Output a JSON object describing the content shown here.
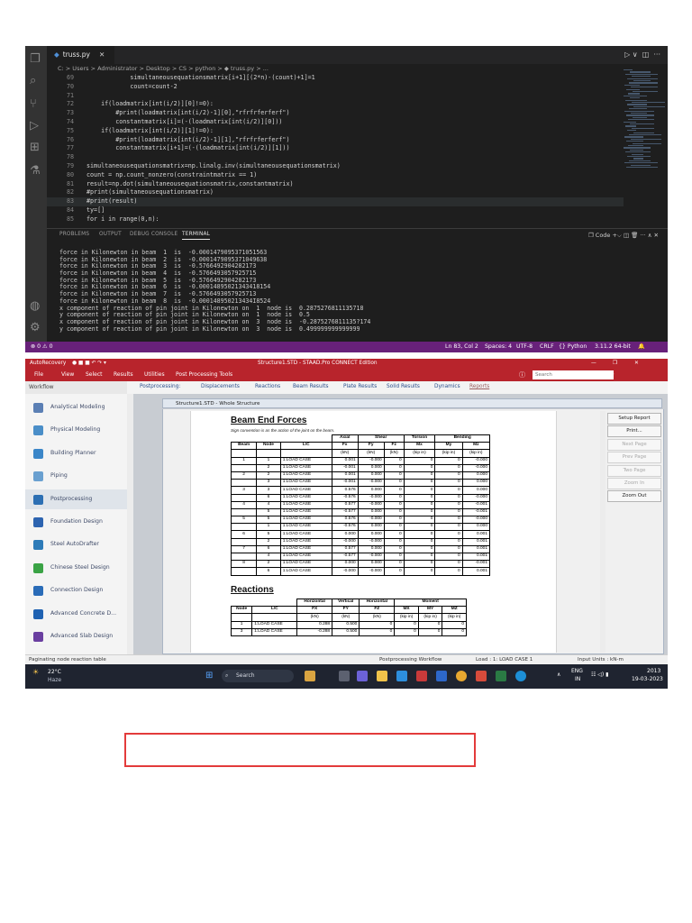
{
  "vscode": {
    "tab_title": "truss.py",
    "tab_icon": "python-file-icon",
    "breadcrumb": "C: > Users > Administrator > Desktop > CS > python > ◆ truss.py > ...",
    "code_lines": [
      {
        "n": "69",
        "text": "            simultaneousequationsmatrix[i+1][(2*n)-(count)+1]=1"
      },
      {
        "n": "70",
        "text": "            count=count-2"
      },
      {
        "n": "71",
        "text": ""
      },
      {
        "n": "72",
        "text": "    if(loadmatrix[int(i/2)][0]!=0):"
      },
      {
        "n": "73",
        "text": "        #print(loadmatrix[int(i/2)-1][0],\"rfrfrferferf\")"
      },
      {
        "n": "74",
        "text": "        constantmatrix[i]=(-(loadmatrix[int(i/2)][0]))"
      },
      {
        "n": "75",
        "text": "    if(loadmatrix[int(i/2)][1]!=0):"
      },
      {
        "n": "76",
        "text": "        #print(loadmatrix[int(i/2)-1][1],\"rfrfrferferf\")"
      },
      {
        "n": "77",
        "text": "        constantmatrix[i+1]=(-(loadmatrix[int(i/2)][1]))"
      },
      {
        "n": "78",
        "text": ""
      },
      {
        "n": "79",
        "text": "simultaneousequationsmatrix=np.linalg.inv(simultaneousequationsmatrix)"
      },
      {
        "n": "80",
        "text": "count = np.count_nonzero(constraintmatrix == 1)"
      },
      {
        "n": "81",
        "text": "result=np.dot(simultaneousequationsmatrix,constantmatrix)"
      },
      {
        "n": "82",
        "text": "#print(simultaneousequationsmatrix)"
      },
      {
        "n": "83",
        "text": "#print(result)"
      },
      {
        "n": "84",
        "text": "ty=[]"
      },
      {
        "n": "85",
        "text": "for i in range(0,n):"
      }
    ],
    "panel_tabs": [
      "PROBLEMS",
      "OUTPUT",
      "DEBUG CONSOLE",
      "TERMINAL"
    ],
    "panel_active": "TERMINAL",
    "panel_actions": "❐ Code  +⌵  ◫  🗑  ···  ∧  ✕",
    "terminal_lines": [
      "force in Kilonewton in beam  1  is  -0.0001479095371051563",
      "force in Kilonewton in beam  2  is  -0.0001479095371049638",
      "force in Kilonewton in beam  3  is  -0.5766492904282173",
      "force in Kilonewton in beam  4  is  -0.5766493057925715",
      "force in Kilonewton in beam  5  is  -0.5766492904282173",
      "force in Kilonewton in beam  6  is  -0.00014895021343418154",
      "force in Kilonewton in beam  7  is  -0.5766493057925713",
      "force in Kilonewton in beam  8  is  -0.000148950213434I8524",
      "x component of reaction of pin joint in Kilonewton on  1  node is  0.2875276811135718",
      "y component of reaction of pin joint in Kilonewton on  1  node is  0.5",
      "x component of reaction of pin joint in Kilonewton on  3  node is  -0.2875276811135?174",
      "y component of reaction of pin joint in Kilonewton on  3  node is  0.499999999999999"
    ],
    "status": {
      "left": "⊗ 0 ⚠ 0",
      "ln_col": "Ln 83, Col 2",
      "spaces": "Spaces: 4",
      "encoding": "UTF-8",
      "eol": "CRLF",
      "language": "{} Python",
      "interpreter": "3.11.2 64-bit"
    },
    "colors": {
      "status_bar": "#68217a",
      "editor_bg": "#1e1e1e"
    }
  },
  "staad": {
    "title": "Structure1.STD - STAAD.Pro CONNECT Edition",
    "autorecovery": "AutoRecovery",
    "menu": [
      "File",
      "View",
      "Select",
      "Results",
      "Utilities",
      "Post Processing Tools"
    ],
    "search_placeholder": "Search",
    "ribbon_tabs": [
      "Postprocessing:",
      "Displacements",
      "Reactions",
      "Beam Results",
      "Plate Results",
      "Solid Results",
      "Dynamics",
      "Reports"
    ],
    "ribbon_active": "Reports",
    "workflow_header": "Workflow",
    "workflow_items": [
      {
        "label": "Analytical Modeling",
        "color": "#5b7fb4"
      },
      {
        "label": "Physical Modeling",
        "color": "#4a8ec8"
      },
      {
        "label": "Building Planner",
        "color": "#3b86c8"
      },
      {
        "label": "Piping",
        "color": "#6aa0d0"
      },
      {
        "label": "Postprocessing",
        "color": "#2c6fb3"
      },
      {
        "label": "Foundation Design",
        "color": "#2d64b0"
      },
      {
        "label": "Steel AutoDrafter",
        "color": "#2d7bb8"
      },
      {
        "label": "Chinese Steel Design",
        "color": "#3aa345"
      },
      {
        "label": "Connection Design",
        "color": "#2a6cb8"
      },
      {
        "label": "Advanced Concrete D...",
        "color": "#1f62b2"
      },
      {
        "label": "Advanced Slab Design",
        "color": "#6a3fa0"
      }
    ],
    "workflow_selected": "Postprocessing",
    "doc_title": "Structure1.STD - Whole Structure",
    "beam_end_forces": {
      "title": "Beam End Forces",
      "note": "Sign convention is as the action of the joint on the beam.",
      "group_headers": [
        "Axial",
        "Shear",
        "Torsion",
        "Bending"
      ],
      "headers": [
        "Beam",
        "Node",
        "L/C",
        "Fx",
        "Fy",
        "Fz",
        "Mx",
        "My",
        "Mz"
      ],
      "units": [
        "",
        "",
        "",
        "(kN)",
        "(kN)",
        "(kN)",
        "(kip in)",
        "(kip in)",
        "(kip in)"
      ],
      "rows": [
        [
          "1",
          "1",
          "1:LOAD CASE",
          "0.001",
          "-0.000",
          "0",
          "0",
          "0",
          "-0.000"
        ],
        [
          "",
          "2",
          "1:LOAD CASE",
          "-0.001",
          "0.000",
          "0",
          "0",
          "0",
          "-0.000"
        ],
        [
          "2",
          "2",
          "1:LOAD CASE",
          "0.001",
          "0.000",
          "0",
          "0",
          "0",
          "0.000"
        ],
        [
          "",
          "3",
          "1:LOAD CASE",
          "-0.001",
          "-0.000",
          "0",
          "0",
          "0",
          "0.000"
        ],
        [
          "3",
          "3",
          "1:LOAD CASE",
          "0.576",
          "0.000",
          "0",
          "0",
          "0",
          "0.000"
        ],
        [
          "",
          "6",
          "1:LOAD CASE",
          "-0.576",
          "-0.000",
          "0",
          "0",
          "0",
          "-0.000"
        ],
        [
          "4",
          "4",
          "1:LOAD CASE",
          "0.577",
          "-0.000",
          "0",
          "0",
          "0",
          "-0.001"
        ],
        [
          "",
          "5",
          "1:LOAD CASE",
          "-0.577",
          "0.000",
          "0",
          "0",
          "0",
          "-0.001"
        ],
        [
          "5",
          "5",
          "1:LOAD CASE",
          "0.576",
          "-0.000",
          "0",
          "0",
          "0",
          "-0.000"
        ],
        [
          "",
          "1",
          "1:LOAD CASE",
          "-0.576",
          "0.000",
          "0",
          "0",
          "0",
          "0.000"
        ],
        [
          "6",
          "5",
          "1:LOAD CASE",
          "0.000",
          "0.000",
          "0",
          "0",
          "0",
          "0.001"
        ],
        [
          "",
          "2",
          "1:LOAD CASE",
          "-0.000",
          "-0.000",
          "0",
          "0",
          "0",
          "0.001"
        ],
        [
          "7",
          "6",
          "1:LOAD CASE",
          "0.577",
          "0.000",
          "0",
          "0",
          "0",
          "0.001"
        ],
        [
          "",
          "4",
          "1:LOAD CASE",
          "-0.577",
          "-0.000",
          "0",
          "0",
          "0",
          "0.001"
        ],
        [
          "8",
          "2",
          "1:LOAD CASE",
          "0.000",
          "0.000",
          "0",
          "0",
          "0",
          "-0.001"
        ],
        [
          "",
          "6",
          "1:LOAD CASE",
          "-0.000",
          "-0.000",
          "0",
          "0",
          "0",
          "0.001"
        ]
      ]
    },
    "reactions": {
      "title": "Reactions",
      "group_headers": [
        "Horizontal",
        "Vertical",
        "Horizontal",
        "Moment"
      ],
      "headers": [
        "Node",
        "L/C",
        "FX",
        "FY",
        "FZ",
        "MX",
        "MY",
        "MZ"
      ],
      "units": [
        "",
        "",
        "(kN)",
        "(kN)",
        "(kN)",
        "(kip in)",
        "(kip in)",
        "(kip in)"
      ],
      "rows": [
        [
          "1",
          "1:LOAD CASE",
          "0.288",
          "0.500",
          "0",
          "0",
          "0",
          "0"
        ],
        [
          "3",
          "1:LOAD CASE",
          "-0.288",
          "0.500",
          "0",
          "0",
          "0",
          "0"
        ]
      ]
    },
    "report_buttons": [
      {
        "label": "Setup Report",
        "enabled": true
      },
      {
        "label": "Print...",
        "enabled": true
      },
      {
        "label": "Next Page",
        "enabled": false
      },
      {
        "label": "Prev Page",
        "enabled": false
      },
      {
        "label": "Two Page",
        "enabled": false
      },
      {
        "label": "Zoom In",
        "enabled": false
      },
      {
        "label": "Zoom Out",
        "enabled": true
      }
    ],
    "statusbar": {
      "left": "Paginating node reaction table",
      "workflow": "Postprocessing Workflow",
      "load": "Load : 1: LOAD CASE 1",
      "units": "Input Units : kN-m"
    },
    "taskbar": {
      "weather_temp": "22°C",
      "weather_desc": "Haze",
      "search": "Search",
      "lang": "ENG",
      "region": "IN",
      "time": "2013",
      "date": "19-03-2023"
    },
    "colors": {
      "title_bar": "#b8242c",
      "taskbar": "#1f2430"
    }
  }
}
